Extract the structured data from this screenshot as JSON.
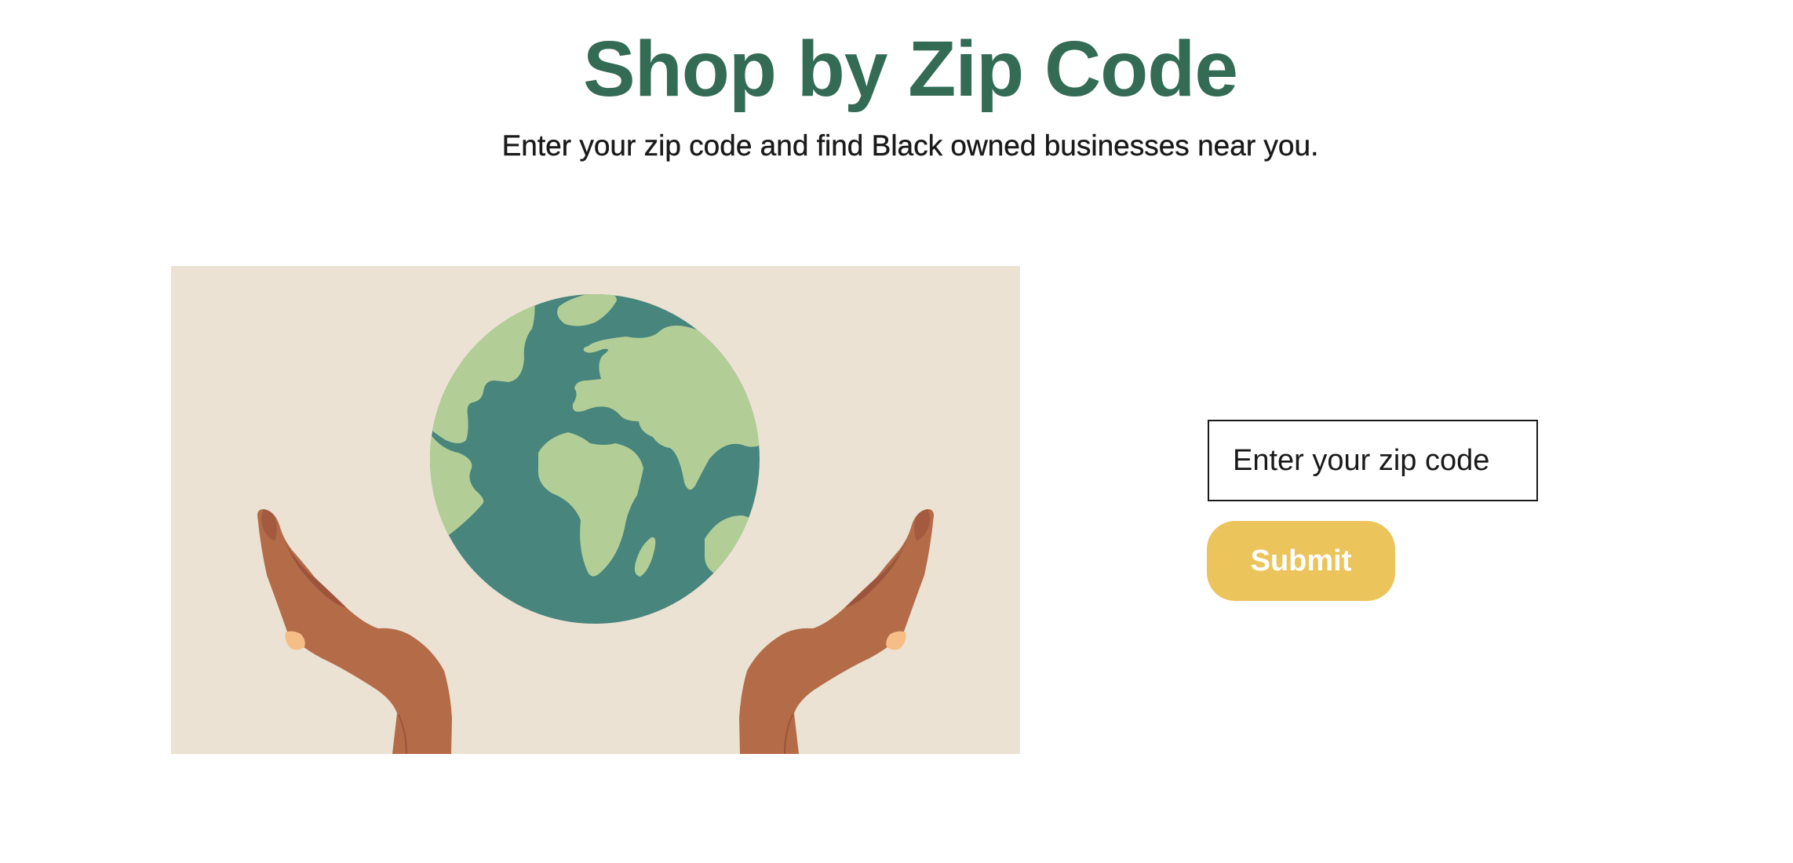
{
  "header": {
    "title": "Shop by Zip Code",
    "subtitle": "Enter your zip code and find Black owned businesses near you."
  },
  "illustration": {
    "icon": "globe-in-hands-illustration",
    "colors": {
      "background": "#ebe2d3",
      "ocean": "#48857d",
      "land": "#b2ce96",
      "skin": "#b36b48",
      "skin_shadow": "#9c553c",
      "nail": "#f6be86"
    }
  },
  "search": {
    "placeholder": "Enter your zip code",
    "value": ""
  },
  "actions": {
    "submit_label": "Submit"
  },
  "theme": {
    "title_color": "#336b55",
    "button_color": "#ebc45c",
    "button_text_color": "#ffffff"
  }
}
